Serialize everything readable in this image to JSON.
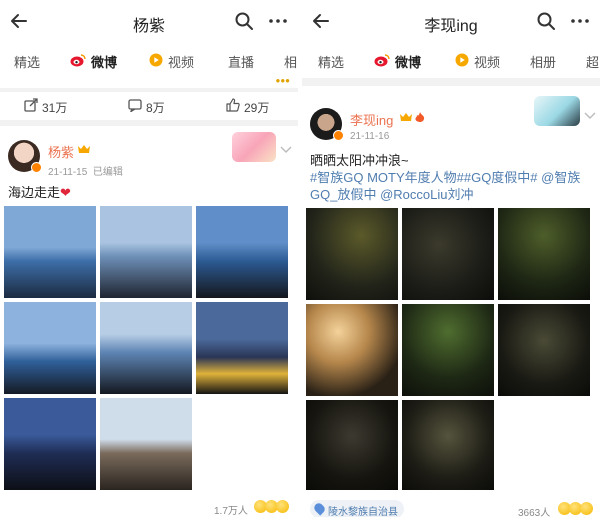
{
  "left": {
    "header": {
      "title": "杨紫"
    },
    "tabs": [
      {
        "label": "精选",
        "active": false
      },
      {
        "label": "微博",
        "active": true,
        "icon": "weibo-icon"
      },
      {
        "label": "视频",
        "active": false,
        "icon": "video-icon"
      },
      {
        "label": "直播",
        "active": false
      },
      {
        "label": "相",
        "active": false
      }
    ],
    "prev_actions": {
      "repost": "31万",
      "comment": "8万",
      "like": "29万"
    },
    "post": {
      "author": "杨紫",
      "time": "21-11-15",
      "edited": "已编辑",
      "text": "海边走走",
      "heart": "❤",
      "image_count": 8,
      "views": "1.7万人"
    }
  },
  "right": {
    "header": {
      "title": "李现ing"
    },
    "tabs": [
      {
        "label": "精选",
        "active": false
      },
      {
        "label": "微博",
        "active": true,
        "icon": "weibo-icon"
      },
      {
        "label": "视频",
        "active": false,
        "icon": "video-icon"
      },
      {
        "label": "相册",
        "active": false
      },
      {
        "label": "超",
        "active": false
      }
    ],
    "post": {
      "author": "李现ing",
      "time": "21-11-16",
      "text_line1": "晒晒太阳冲冲浪~",
      "text_line2": "#智族GQ MOTY年度人物##GQ度假中# @智族",
      "text_line3": "GQ_放假中 @RoccoLiu刘冲",
      "image_count": 8,
      "views": "3663人",
      "location": "陵水黎族自治县"
    }
  },
  "colors": {
    "accent_orange": "#ff8200",
    "username": "#eb7350",
    "link_blue": "#507daf",
    "weibo_red": "#e6162d"
  }
}
